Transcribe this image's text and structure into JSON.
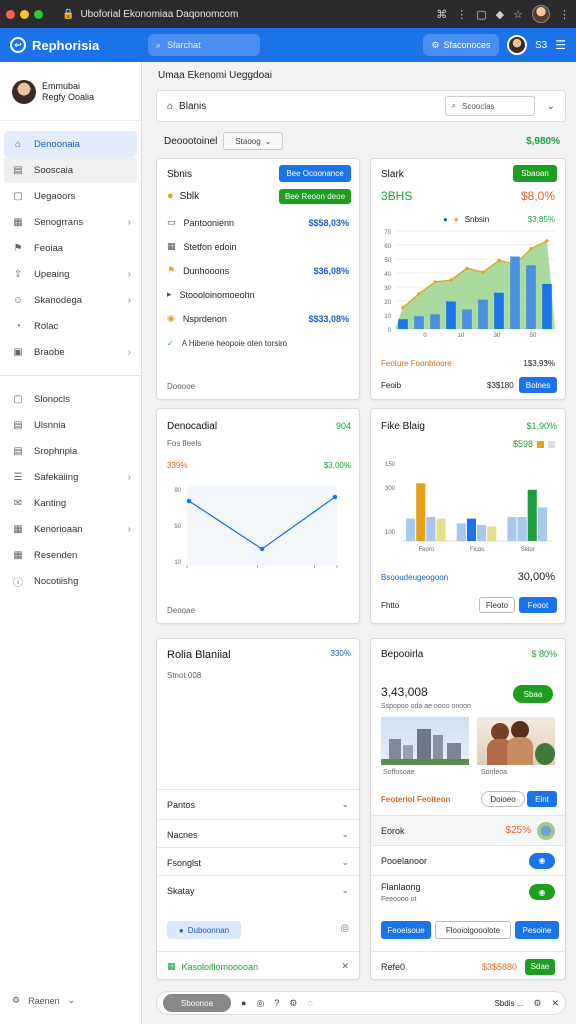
{
  "browser": {
    "url": "Uboforial Ekonomiaa Daqonomcom",
    "colors": {
      "close": "#ff5f57",
      "minimize": "#febc2e",
      "maximize": "#28c840"
    }
  },
  "app": {
    "brand": "Rephorisia",
    "search_placeholder": "Sfarchat",
    "action_label": "Sfaconoces",
    "icons_text": "S3",
    "accent": "#1a73e8"
  },
  "sidebar": {
    "profile": {
      "name": "Emmubai",
      "subtitle": "Regfy Ooalia"
    },
    "items_a": [
      {
        "label": "Denoonaia",
        "icon": "home-icon",
        "active": true
      },
      {
        "label": "Sooscaia",
        "icon": "chart-icon",
        "hover": true
      },
      {
        "label": "Uegaoors",
        "icon": "box-icon"
      },
      {
        "label": "Senogrrans",
        "icon": "grid-icon",
        "chevron": true
      },
      {
        "label": "Feoiaa",
        "icon": "tag-icon"
      },
      {
        "label": "Upeaing",
        "icon": "upload-icon",
        "chevron": true
      },
      {
        "label": "Skanodega",
        "icon": "users-icon",
        "chevron": true
      },
      {
        "label": "Rolac",
        "icon": "clock-icon"
      },
      {
        "label": "Braobe",
        "icon": "image-icon",
        "chevron": true
      }
    ],
    "items_b": [
      {
        "label": "Slonocls",
        "icon": "file-icon"
      },
      {
        "label": "Ulsnnia",
        "icon": "doc-icon"
      },
      {
        "label": "Srophnpia",
        "icon": "doc-icon"
      },
      {
        "label": "Safekaiing",
        "icon": "list-icon",
        "chevron": true
      },
      {
        "label": "Kanting",
        "icon": "mail-icon"
      },
      {
        "label": "Kenorioaan",
        "icon": "grid-icon",
        "chevron": true
      },
      {
        "label": "Resenden",
        "icon": "calendar-icon"
      },
      {
        "label": "Nocotiishg",
        "icon": "info-icon"
      }
    ],
    "footer": "Raenen"
  },
  "main": {
    "crumb": "Umaa Ekenomi  Ueggdoai",
    "searchbar": {
      "title": "Blanis",
      "search_placeholder": "Scooclas"
    },
    "toolrow": {
      "label": "Deoootoinel",
      "select": "Staoog",
      "right_value": "$,980%"
    },
    "card1": {
      "title": "Sbnis",
      "button": "Bee Ocoonance",
      "balance_label": "Sblk",
      "balance_button": "Bee Reoon deoe",
      "rows": [
        {
          "label": "Pantoonienn",
          "value": "$$58,03%",
          "icon": "card-icon"
        },
        {
          "label": "Stetfon edoin",
          "value": "",
          "icon": "calendar-icon"
        },
        {
          "label": "Dunhooons",
          "value": "$36,08%",
          "icon": "tag-icon"
        },
        {
          "label": "Stoooloinomoeohn",
          "value": "",
          "icon": "arrow-icon"
        },
        {
          "label": "Nsprdenon",
          "value": "$$33,08%",
          "icon": "coin-icon"
        }
      ],
      "note": "A Hibene heopoie oten torsiro",
      "footer": "Dooooe"
    },
    "card2": {
      "title": "Slark",
      "button": "Sbaoan",
      "value": "3BHS",
      "value_right": "$8,0%",
      "legend": "Snbsin",
      "legend_value": "$3,85%",
      "footer_left": "Feoture Foonbtoore",
      "footer_value": "1$3,93%",
      "bottom_left": "Feoib",
      "bottom_value": "$3$180",
      "bottom_button": "Bolnes"
    },
    "card3": {
      "title": "Denocadial",
      "badge": "904",
      "sub": "Fos fleels",
      "left_value": "339%",
      "right_value": "$3,00%",
      "footer": "Deooae"
    },
    "card4": {
      "title": "Fike Blaig",
      "right": "$1,90%",
      "sub_value": "$598",
      "footer_label": "Bsooudeugeogoon",
      "footer_value": "30,00%",
      "bottom_left": "Fhtto",
      "btn_outline": "Fleoto",
      "btn_blue": "Feoot"
    },
    "card5": {
      "title": "Rolia Blaniial",
      "right": "330%",
      "sub": "Stnot 008",
      "rows": [
        "Pantos",
        "Nacnes",
        "Fsonglst",
        "Skatay"
      ],
      "chip": "Duboonnan",
      "footer": "Kasoloiflomooooan"
    },
    "card6": {
      "title": "Bepooirla",
      "right": "$ 80%",
      "value": "3,43,008",
      "sub": "Sspopoo oda ae oooo onoon",
      "button": "Sbaa",
      "thumb1": "Soffosoae",
      "thumb2": "Sonfeoa",
      "promo": "Feoteriol Feoiteon",
      "promo_btn_outline": "Doioeo",
      "promo_btn_blue": "Eint",
      "row1": "Eorok",
      "row1_value": "$25%",
      "row2": "Pooelanoor",
      "row3": "Flanlaong",
      "row3_sub": "Feeoooo ot",
      "btns": [
        "Feoeisoue",
        "Flooioigooolote",
        "Pesoine"
      ],
      "bottom_left": "Refe0",
      "bottom_value": "$3$5880",
      "bottom_btn": "Sdae"
    },
    "bottom_bar": {
      "pill": "Sboonoa",
      "right": "Sbdis ..."
    }
  },
  "chart_data": [
    {
      "type": "bar",
      "categories": [
        "1",
        "2",
        "3",
        "4",
        "5",
        "6",
        "7",
        "8",
        "9",
        "10"
      ],
      "series": [
        {
          "values": [
            10,
            13,
            15,
            28,
            20,
            30,
            37,
            74,
            65,
            46
          ]
        },
        {
          "values": [
            22,
            36,
            48,
            50,
            62,
            58,
            70,
            66,
            82,
            90
          ]
        }
      ],
      "ylim": [
        0,
        100
      ],
      "y_ticks": [
        "0",
        "10",
        "20",
        "30",
        "40",
        "50",
        "60",
        "70"
      ]
    },
    {
      "type": "line",
      "x": [
        0,
        1,
        2
      ],
      "values": [
        80,
        20,
        85
      ],
      "ylim": [
        0,
        100
      ],
      "y_ticks": [
        "90",
        "50",
        "10"
      ]
    },
    {
      "type": "bar",
      "categories": [
        "A",
        "B",
        "C"
      ],
      "series": [
        {
          "values": [
            28,
            22,
            30
          ]
        },
        {
          "values": [
            72,
            28,
            30
          ]
        },
        {
          "values": [
            30,
            20,
            64
          ]
        },
        {
          "values": [
            28,
            18,
            42
          ]
        }
      ],
      "ylim": [
        0,
        100
      ],
      "y_ticks": [
        "150",
        "300",
        "100"
      ],
      "x_ticks": [
        "Feoro",
        "Flcos",
        "Selor"
      ]
    }
  ]
}
